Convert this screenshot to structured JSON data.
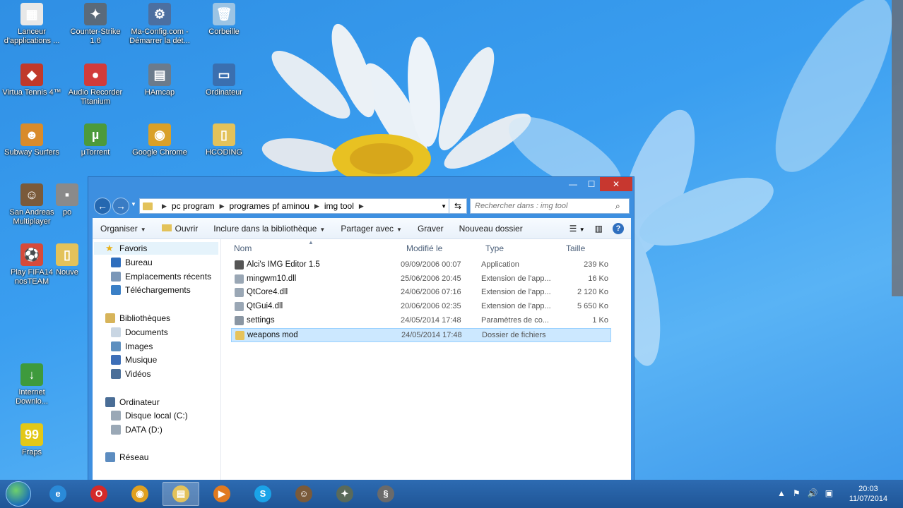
{
  "desktop": {
    "icons": [
      {
        "label": "Lanceur\nd'applications ...",
        "color": "#e8e8e8",
        "glyph": "▦",
        "icon": "launcher-icon"
      },
      {
        "label": "Counter-Strike\n1.6",
        "color": "#5a6a7a",
        "glyph": "✦",
        "icon": "counter-strike-icon"
      },
      {
        "label": "Ma-Config.com -\nDémarrer la dét...",
        "color": "#4c6fa0",
        "glyph": "⚙",
        "icon": "maconfig-icon"
      },
      {
        "label": "Corbeille",
        "color": "#9cc4e4",
        "glyph": "🗑",
        "icon": "recycle-bin-icon"
      },
      {
        "label": "Virtua Tennis 4™",
        "color": "#c0392b",
        "glyph": "◆",
        "icon": "virtua-tennis-icon"
      },
      {
        "label": "Audio Recorder\nTitanium",
        "color": "#d23b3b",
        "glyph": "●",
        "icon": "audio-recorder-icon"
      },
      {
        "label": "HAmcap",
        "color": "#6b7b8c",
        "glyph": "▤",
        "icon": "hamcap-icon"
      },
      {
        "label": "Ordinateur",
        "color": "#3a6fb0",
        "glyph": "▭",
        "icon": "computer-icon"
      },
      {
        "label": "Subway Surfers",
        "color": "#d98b2b",
        "glyph": "☻",
        "icon": "subway-surfers-icon"
      },
      {
        "label": "µTorrent",
        "color": "#4c9a3b",
        "glyph": "µ",
        "icon": "utorrent-icon"
      },
      {
        "label": "Google Chrome",
        "color": "#d9a028",
        "glyph": "◉",
        "icon": "chrome-icon"
      },
      {
        "label": "HCODING",
        "color": "#e3c25a",
        "glyph": "▯",
        "icon": "folder-icon"
      },
      {
        "label": "San Andreas\nMultiplayer",
        "color": "#7a5a3a",
        "glyph": "☺",
        "icon": "samp-icon"
      },
      {
        "label": "po",
        "color": "#8a8a8a",
        "glyph": "▪",
        "icon": "partial-icon"
      },
      {
        "label": "Play FIFA14\nnosTEAM",
        "color": "#d64a3a",
        "glyph": "⚽",
        "icon": "fifa-icon"
      },
      {
        "label": "Nouve",
        "color": "#e3c25a",
        "glyph": "▯",
        "icon": "partial-folder-icon"
      },
      {
        "label": "Internet\nDownlo...",
        "color": "#3e9a3c",
        "glyph": "↓",
        "icon": "idm-icon"
      },
      {
        "label": "Fraps",
        "color": "#e2c818",
        "glyph": "99",
        "icon": "fraps-icon"
      }
    ]
  },
  "window": {
    "controls": {
      "minimize": "—",
      "maximize": "☐",
      "close": "✕"
    },
    "breadcrumb": [
      "pc program",
      "programes pf aminou",
      "img tool"
    ],
    "search_placeholder": "Rechercher dans : img tool",
    "toolbar": {
      "organize": "Organiser",
      "open": "Ouvrir",
      "include": "Inclure dans la bibliothèque",
      "share": "Partager avec",
      "burn": "Graver",
      "new_folder": "Nouveau dossier"
    },
    "nav": {
      "favorites": "Favoris",
      "desktop": "Bureau",
      "recent": "Emplacements récents",
      "downloads": "Téléchargements",
      "libraries": "Bibliothèques",
      "documents": "Documents",
      "images": "Images",
      "music": "Musique",
      "videos": "Vidéos",
      "computer": "Ordinateur",
      "disk_c": "Disque local (C:)",
      "disk_d": "DATA (D:)",
      "network": "Réseau"
    },
    "columns": {
      "name": "Nom",
      "modified": "Modifié le",
      "type": "Type",
      "size": "Taille"
    },
    "files": [
      {
        "name": "Alci's IMG Editor 1.5",
        "date": "09/09/2006 00:07",
        "type": "Application",
        "size": "239 Ko",
        "icon": "application-icon",
        "color": "#555"
      },
      {
        "name": "mingwm10.dll",
        "date": "25/06/2006 20:45",
        "type": "Extension de l'app...",
        "size": "16 Ko",
        "icon": "dll-icon",
        "color": "#9aa7b5"
      },
      {
        "name": "QtCore4.dll",
        "date": "24/06/2006 07:16",
        "type": "Extension de l'app...",
        "size": "2 120 Ko",
        "icon": "dll-icon",
        "color": "#9aa7b5"
      },
      {
        "name": "QtGui4.dll",
        "date": "20/06/2006 02:35",
        "type": "Extension de l'app...",
        "size": "5 650 Ko",
        "icon": "dll-icon",
        "color": "#9aa7b5"
      },
      {
        "name": "settings",
        "date": "24/05/2014 17:48",
        "type": "Paramètres de co...",
        "size": "1 Ko",
        "icon": "settings-file-icon",
        "color": "#8a96a3"
      },
      {
        "name": "weapons mod",
        "date": "24/05/2014 17:48",
        "type": "Dossier de fichiers",
        "size": "",
        "icon": "folder-icon",
        "color": "#e6c35c"
      }
    ]
  },
  "taskbar": {
    "items": [
      {
        "icon": "internet-explorer-icon",
        "glyph": "e",
        "color": "#2a8ad8"
      },
      {
        "icon": "opera-icon",
        "glyph": "O",
        "color": "#d42a2a"
      },
      {
        "icon": "chrome-icon",
        "glyph": "◉",
        "color": "#e0a020"
      },
      {
        "icon": "file-explorer-icon",
        "glyph": "▤",
        "color": "#e3c25a"
      },
      {
        "icon": "media-player-icon",
        "glyph": "▶",
        "color": "#e07a20"
      },
      {
        "icon": "skype-icon",
        "glyph": "S",
        "color": "#1aa3e8"
      },
      {
        "icon": "samp-icon",
        "glyph": "☺",
        "color": "#7a5a3a"
      },
      {
        "icon": "gta-icon",
        "glyph": "✦",
        "color": "#5a6a5a"
      },
      {
        "icon": "tool-icon",
        "glyph": "§",
        "color": "#6a6a6a"
      }
    ],
    "tray": {
      "arrow": "▲",
      "flag": "⚑",
      "volume": "🔊",
      "network": "▣"
    },
    "time": "20:03",
    "date": "11/07/2014"
  }
}
